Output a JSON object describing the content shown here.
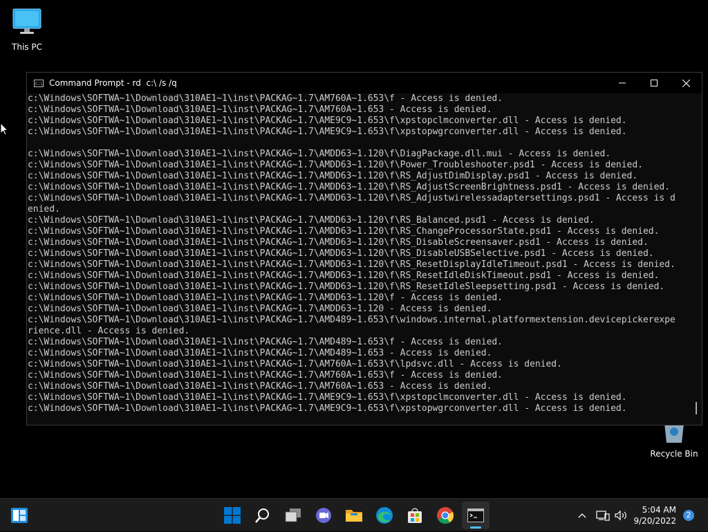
{
  "desktop": {
    "icons": [
      {
        "label": "This PC"
      },
      {
        "label": "Recycle Bin"
      }
    ]
  },
  "window": {
    "title": "Command Prompt - rd  c:\\ /s /q",
    "console_lines": [
      "c:\\Windows\\SOFTWA~1\\Download\\310AE1~1\\inst\\PACKAG~1.7\\AM760A~1.653\\f - Access is denied.",
      "c:\\Windows\\SOFTWA~1\\Download\\310AE1~1\\inst\\PACKAG~1.7\\AM760A~1.653 - Access is denied.",
      "c:\\Windows\\SOFTWA~1\\Download\\310AE1~1\\inst\\PACKAG~1.7\\AME9C9~1.653\\f\\xpstopclmconverter.dll - Access is denied.",
      "c:\\Windows\\SOFTWA~1\\Download\\310AE1~1\\inst\\PACKAG~1.7\\AME9C9~1.653\\f\\xpstopwgrconverter.dll - Access is denied.",
      "",
      "c:\\Windows\\SOFTWA~1\\Download\\310AE1~1\\inst\\PACKAG~1.7\\AMDD63~1.120\\f\\DiagPackage.dll.mui - Access is denied.",
      "c:\\Windows\\SOFTWA~1\\Download\\310AE1~1\\inst\\PACKAG~1.7\\AMDD63~1.120\\f\\Power_Troubleshooter.psd1 - Access is denied.",
      "c:\\Windows\\SOFTWA~1\\Download\\310AE1~1\\inst\\PACKAG~1.7\\AMDD63~1.120\\f\\RS_AdjustDimDisplay.psd1 - Access is denied.",
      "c:\\Windows\\SOFTWA~1\\Download\\310AE1~1\\inst\\PACKAG~1.7\\AMDD63~1.120\\f\\RS_AdjustScreenBrightness.psd1 - Access is denied.",
      "c:\\Windows\\SOFTWA~1\\Download\\310AE1~1\\inst\\PACKAG~1.7\\AMDD63~1.120\\f\\RS_Adjustwirelessadaptersettings.psd1 - Access is d",
      "enied.",
      "c:\\Windows\\SOFTWA~1\\Download\\310AE1~1\\inst\\PACKAG~1.7\\AMDD63~1.120\\f\\RS_Balanced.psd1 - Access is denied.",
      "c:\\Windows\\SOFTWA~1\\Download\\310AE1~1\\inst\\PACKAG~1.7\\AMDD63~1.120\\f\\RS_ChangeProcessorState.psd1 - Access is denied.",
      "c:\\Windows\\SOFTWA~1\\Download\\310AE1~1\\inst\\PACKAG~1.7\\AMDD63~1.120\\f\\RS_DisableScreensaver.psd1 - Access is denied.",
      "c:\\Windows\\SOFTWA~1\\Download\\310AE1~1\\inst\\PACKAG~1.7\\AMDD63~1.120\\f\\RS_DisableUSBSelective.psd1 - Access is denied.",
      "c:\\Windows\\SOFTWA~1\\Download\\310AE1~1\\inst\\PACKAG~1.7\\AMDD63~1.120\\f\\RS_ResetDisplayIdleTimeout.psd1 - Access is denied.",
      "c:\\Windows\\SOFTWA~1\\Download\\310AE1~1\\inst\\PACKAG~1.7\\AMDD63~1.120\\f\\RS_ResetIdleDiskTimeout.psd1 - Access is denied.",
      "c:\\Windows\\SOFTWA~1\\Download\\310AE1~1\\inst\\PACKAG~1.7\\AMDD63~1.120\\f\\RS_ResetIdleSleepsetting.psd1 - Access is denied.",
      "c:\\Windows\\SOFTWA~1\\Download\\310AE1~1\\inst\\PACKAG~1.7\\AMDD63~1.120\\f - Access is denied.",
      "c:\\Windows\\SOFTWA~1\\Download\\310AE1~1\\inst\\PACKAG~1.7\\AMDD63~1.120 - Access is denied.",
      "c:\\Windows\\SOFTWA~1\\Download\\310AE1~1\\inst\\PACKAG~1.7\\AMD489~1.653\\f\\windows.internal.platformextension.devicepickerexpe",
      "rience.dll - Access is denied.",
      "c:\\Windows\\SOFTWA~1\\Download\\310AE1~1\\inst\\PACKAG~1.7\\AMD489~1.653\\f - Access is denied.",
      "c:\\Windows\\SOFTWA~1\\Download\\310AE1~1\\inst\\PACKAG~1.7\\AMD489~1.653 - Access is denied.",
      "c:\\Windows\\SOFTWA~1\\Download\\310AE1~1\\inst\\PACKAG~1.7\\AM760A~1.653\\f\\lpdsvc.dll - Access is denied.",
      "c:\\Windows\\SOFTWA~1\\Download\\310AE1~1\\inst\\PACKAG~1.7\\AM760A~1.653\\f - Access is denied.",
      "c:\\Windows\\SOFTWA~1\\Download\\310AE1~1\\inst\\PACKAG~1.7\\AM760A~1.653 - Access is denied.",
      "c:\\Windows\\SOFTWA~1\\Download\\310AE1~1\\inst\\PACKAG~1.7\\AME9C9~1.653\\f\\xpstopclmconverter.dll - Access is denied.",
      "c:\\Windows\\SOFTWA~1\\Download\\310AE1~1\\inst\\PACKAG~1.7\\AME9C9~1.653\\f\\xpstopwgrconverter.dll - Access is denied."
    ]
  },
  "taskbar": {
    "pinned": [
      {
        "name": "start-button",
        "icon": "windows-logo-icon"
      },
      {
        "name": "search-button",
        "icon": "search-icon"
      },
      {
        "name": "task-view-button",
        "icon": "task-view-icon"
      },
      {
        "name": "chat-button",
        "icon": "chat-icon"
      },
      {
        "name": "file-explorer-button",
        "icon": "folder-icon"
      },
      {
        "name": "edge-button",
        "icon": "edge-icon"
      },
      {
        "name": "store-button",
        "icon": "store-icon"
      },
      {
        "name": "chrome-button",
        "icon": "chrome-icon"
      },
      {
        "name": "terminal-button",
        "icon": "terminal-icon",
        "active": true
      }
    ],
    "clock": {
      "time": "5:04 AM",
      "date": "9/20/2022"
    },
    "notification_count": "2"
  },
  "colors": {
    "console_bg": "#0c0c0c",
    "console_fg": "#cccccc",
    "accent": "#4cc2ff",
    "start_blue": "#0078d4"
  }
}
